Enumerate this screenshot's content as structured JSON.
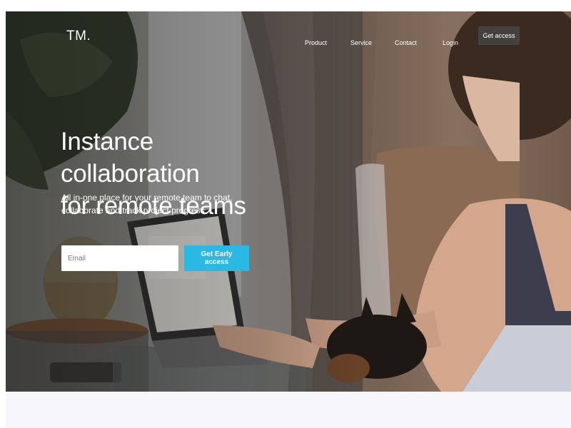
{
  "brand": {
    "logo": "TM",
    "logo_dot": "."
  },
  "nav": {
    "items": [
      {
        "label": "Product"
      },
      {
        "label": "Service"
      },
      {
        "label": "Contact"
      },
      {
        "label": "Login"
      }
    ],
    "cta_label": "Get access"
  },
  "hero": {
    "title_line1": "Instance collaboration",
    "title_line2": "for remote teams",
    "subtitle_line1": "All in-one place for your remote team to chat,",
    "subtitle_line2": "collaborate and track project progress",
    "email_placeholder": "Email",
    "email_value": "",
    "cta_label": "Get Early access"
  },
  "colors": {
    "accent": "#2ab9e3",
    "nav_cta_bg": "#464646",
    "text_on_image": "#ffffff",
    "below_hero_bg": "#f7f7fb"
  }
}
